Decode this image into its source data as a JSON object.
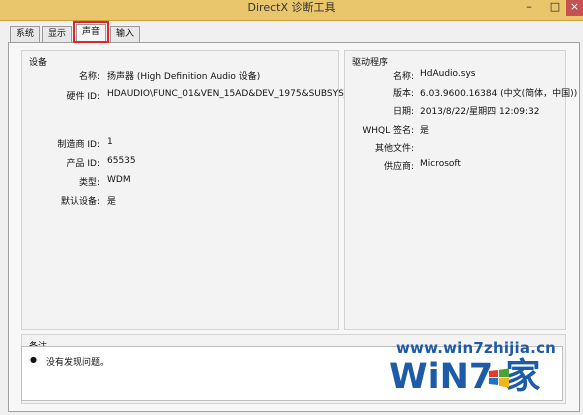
{
  "window": {
    "title": "DirectX 诊断工具",
    "minimize_glyph": "–",
    "maximize_glyph": "□",
    "close_glyph": "×"
  },
  "tabs": [
    {
      "label": "系统"
    },
    {
      "label": "显示"
    },
    {
      "label": "声音",
      "active": true
    },
    {
      "label": "输入"
    }
  ],
  "device": {
    "title": "设备",
    "fields": [
      {
        "label": "名称:",
        "value": "扬声器 (High Definition Audio 设备)"
      },
      {
        "label": "硬件 ID:",
        "value": "HDAUDIO\\FUNC_01&VEN_15AD&DEV_1975&SUBSYS_"
      },
      {
        "label": "制造商 ID:",
        "value": "1"
      },
      {
        "label": "产品 ID:",
        "value": "65535"
      },
      {
        "label": "类型:",
        "value": "WDM"
      },
      {
        "label": "默认设备:",
        "value": "是"
      }
    ]
  },
  "driver": {
    "title": "驱动程序",
    "fields": [
      {
        "label": "名称:",
        "value": "HdAudio.sys"
      },
      {
        "label": "版本:",
        "value": "6.03.9600.16384 (中文(简体，中国))"
      },
      {
        "label": "日期:",
        "value": "2013/8/22/星期四 12:09:32"
      },
      {
        "label": "WHQL 签名:",
        "value": "是"
      },
      {
        "label": "其他文件:",
        "value": ""
      },
      {
        "label": "供应商:",
        "value": "Microsoft"
      }
    ]
  },
  "notes": {
    "title": "备注",
    "items": [
      "没有发现问题。"
    ]
  },
  "watermark": {
    "site": "www.win7zhijia.cn",
    "logo": "WiN7 家"
  },
  "colors": {
    "titlebar": "#e9c66b",
    "tab_highlight": "#e0262a",
    "watermark": "#1d5aa8"
  }
}
